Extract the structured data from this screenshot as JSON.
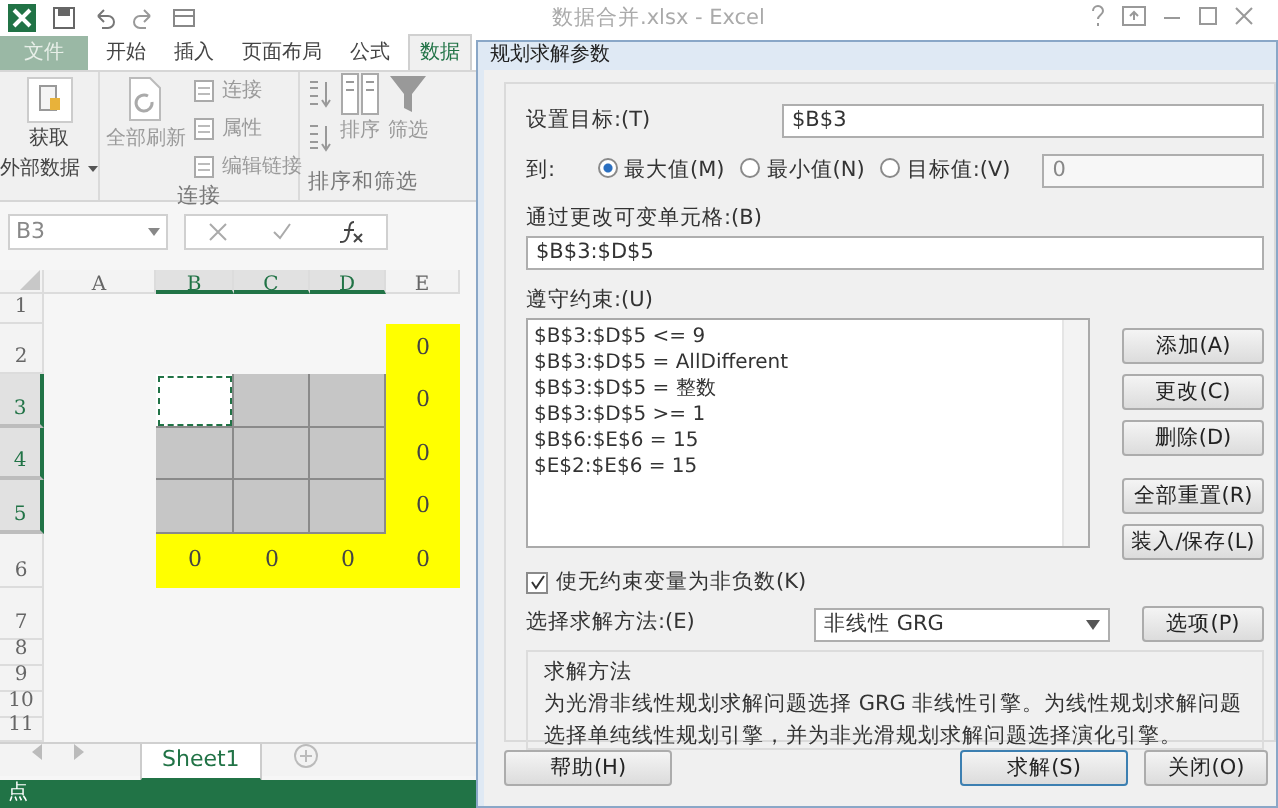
{
  "excel": {
    "title": "数据合并.xlsx - Excel",
    "ribbon_tabs": [
      {
        "label": "文件",
        "selected": false
      },
      {
        "label": "开始",
        "selected": false
      },
      {
        "label": "插入",
        "selected": false
      },
      {
        "label": "页面布局",
        "selected": false
      },
      {
        "label": "公式",
        "selected": false
      },
      {
        "label": "数据",
        "selected": true
      }
    ],
    "ribbon": {
      "get_data": "获取",
      "get_data_2": "外部数据",
      "refresh_all": "全部刷新",
      "connections": "连接",
      "properties": "属性",
      "edit_links": "编辑链接",
      "group_connections": "连接",
      "sort": "排序",
      "filter": "筛选",
      "group_sort_filter": "排序和筛选"
    },
    "name_box": "B3",
    "columns": [
      {
        "label": "A",
        "selected": false
      },
      {
        "label": "B",
        "selected": true
      },
      {
        "label": "C",
        "selected": true
      },
      {
        "label": "D",
        "selected": true
      },
      {
        "label": "E",
        "selected": false
      }
    ],
    "rows": [
      {
        "label": "1",
        "selected": false,
        "cells": [
          {
            "kind": "plain"
          },
          {
            "kind": "plain"
          },
          {
            "kind": "plain"
          },
          {
            "kind": "plain"
          },
          {
            "kind": "plain"
          }
        ]
      },
      {
        "label": "2",
        "selected": false,
        "cells": [
          {
            "kind": "plain"
          },
          {
            "kind": "plain"
          },
          {
            "kind": "plain"
          },
          {
            "kind": "plain"
          },
          {
            "kind": "highlight",
            "text": "0"
          }
        ]
      },
      {
        "label": "3",
        "selected": true,
        "cells": [
          {
            "kind": "plain"
          },
          {
            "kind": "active"
          },
          {
            "kind": "selection"
          },
          {
            "kind": "selection"
          },
          {
            "kind": "highlight",
            "text": "0"
          }
        ]
      },
      {
        "label": "4",
        "selected": true,
        "cells": [
          {
            "kind": "plain"
          },
          {
            "kind": "selection"
          },
          {
            "kind": "selection"
          },
          {
            "kind": "selection"
          },
          {
            "kind": "highlight",
            "text": "0"
          }
        ]
      },
      {
        "label": "5",
        "selected": true,
        "cells": [
          {
            "kind": "plain"
          },
          {
            "kind": "selection"
          },
          {
            "kind": "selection"
          },
          {
            "kind": "selection"
          },
          {
            "kind": "highlight",
            "text": "0"
          }
        ]
      },
      {
        "label": "6",
        "selected": false,
        "cells": [
          {
            "kind": "plain"
          },
          {
            "kind": "highlight",
            "text": "0"
          },
          {
            "kind": "highlight",
            "text": "0"
          },
          {
            "kind": "highlight",
            "text": "0"
          },
          {
            "kind": "highlight",
            "text": "0"
          }
        ]
      },
      {
        "label": "7",
        "selected": false,
        "cells": [
          {
            "kind": "plain"
          },
          {
            "kind": "plain"
          },
          {
            "kind": "plain"
          },
          {
            "kind": "plain"
          },
          {
            "kind": "plain"
          }
        ]
      },
      {
        "label": "8",
        "selected": false,
        "cells": [
          {
            "kind": "plain"
          },
          {
            "kind": "plain"
          },
          {
            "kind": "plain"
          },
          {
            "kind": "plain"
          },
          {
            "kind": "plain"
          }
        ]
      },
      {
        "label": "9",
        "selected": false,
        "cells": [
          {
            "kind": "plain"
          },
          {
            "kind": "plain"
          },
          {
            "kind": "plain"
          },
          {
            "kind": "plain"
          },
          {
            "kind": "plain"
          }
        ]
      },
      {
        "label": "10",
        "selected": false,
        "cells": [
          {
            "kind": "plain"
          },
          {
            "kind": "plain"
          },
          {
            "kind": "plain"
          },
          {
            "kind": "plain"
          },
          {
            "kind": "plain"
          }
        ]
      },
      {
        "label": "11",
        "selected": false,
        "cells": [
          {
            "kind": "plain"
          },
          {
            "kind": "plain"
          },
          {
            "kind": "plain"
          },
          {
            "kind": "plain"
          },
          {
            "kind": "plain"
          }
        ]
      }
    ],
    "sheet_tabs": [
      {
        "label": "Sheet1",
        "selected": true
      }
    ],
    "status_bar": "点"
  },
  "dialog": {
    "title": "规划求解参数",
    "objective_label": "设置目标:(T)",
    "objective_value": "$B$3",
    "to_label": "到:",
    "to_options": [
      {
        "label": "最大值(M)",
        "selected": true
      },
      {
        "label": "最小值(N)",
        "selected": false
      },
      {
        "label": "目标值:(V)",
        "selected": false
      }
    ],
    "target_value": "0",
    "changing_label": "通过更改可变单元格:(B)",
    "changing_value": "$B$3:$D$5",
    "constraints_label": "遵守约束:(U)",
    "constraints": [
      "$B$3:$D$5 <= 9",
      "$B$3:$D$5 = AllDifferent",
      "$B$3:$D$5 = 整数",
      "$B$3:$D$5 >= 1",
      "$B$6:$E$6 = 15",
      "$E$2:$E$6 = 15"
    ],
    "constraint_buttons": [
      "添加(A)",
      "更改(C)",
      "删除(D)",
      "全部重置(R)",
      "装入/保存(L)"
    ],
    "nonnegative": {
      "label": "使无约束变量为非负数(K)",
      "checked": true
    },
    "method_label": "选择求解方法:(E)",
    "method_value": "非线性 GRG",
    "options_button": "选项(P)",
    "method_box": {
      "title": "求解方法",
      "text": "为光滑非线性规划求解问题选择 GRG 非线性引擎。为线性规划求解问题选择单纯线性规划引擎，并为非光滑规划求解问题选择演化引擎。"
    },
    "help_button": "帮助(H)",
    "solve_button": "求解(S)",
    "close_button": "关闭(O)"
  }
}
